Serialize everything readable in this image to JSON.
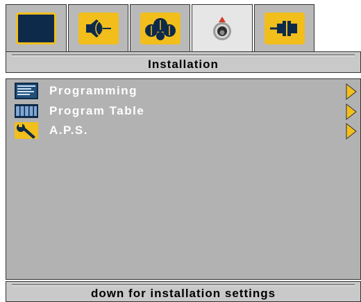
{
  "tabs": [
    {
      "name": "picture",
      "icon": "tv-screen-icon",
      "active": false
    },
    {
      "name": "sound",
      "icon": "speaker-icon",
      "active": false
    },
    {
      "name": "features",
      "icon": "features-icon",
      "active": false
    },
    {
      "name": "installation",
      "icon": "installation-icon",
      "active": true
    },
    {
      "name": "connections",
      "icon": "connector-icon",
      "active": false
    }
  ],
  "header": {
    "title": "Installation"
  },
  "menu": {
    "items": [
      {
        "label": "Programming",
        "icon": "programming-icon"
      },
      {
        "label": "Program Table",
        "icon": "program-table-icon"
      },
      {
        "label": "A.P.S.",
        "icon": "wrench-icon"
      }
    ]
  },
  "footer": {
    "hint": "down for installation settings"
  },
  "colors": {
    "accent_yellow": "#f1be1c",
    "panel_grey": "#b2b2b2",
    "bar_grey": "#c9c9c9",
    "icon_navy": "#0e2a4a"
  }
}
